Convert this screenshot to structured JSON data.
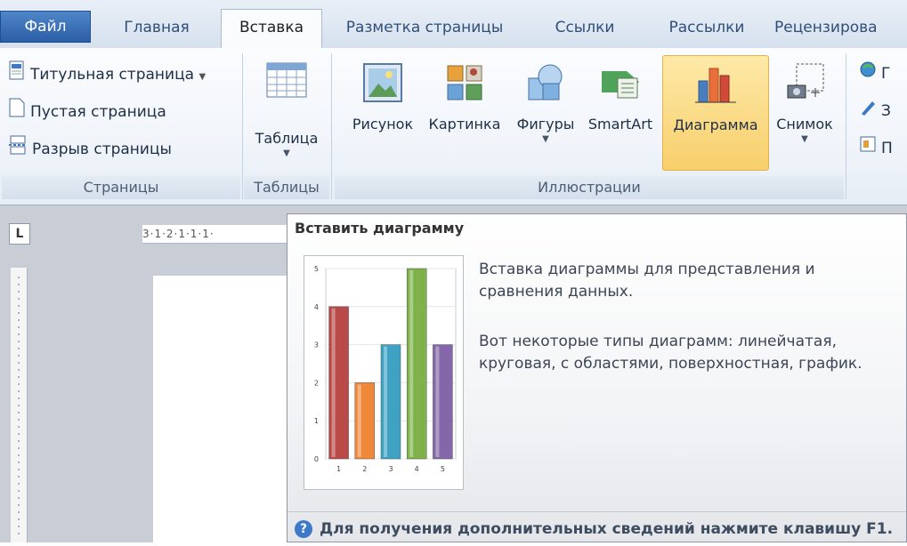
{
  "tabs": [
    "Файл",
    "Главная",
    "Вставка",
    "Разметка страницы",
    "Ссылки",
    "Рассылки",
    "Рецензирова"
  ],
  "active_tab": "Вставка",
  "groups": {
    "pages": {
      "label": "Страницы",
      "items": [
        "Титульная страница",
        "Пустая страница",
        "Разрыв страницы"
      ]
    },
    "tables": {
      "label": "Таблицы",
      "table_button": "Таблица"
    },
    "illustrations": {
      "label": "Иллюстрации",
      "buttons": [
        "Рисунок",
        "Картинка",
        "Фигуры",
        "SmartArt",
        "Диаграмма",
        "Снимок"
      ]
    },
    "links": {
      "items": [
        "Г",
        "З",
        "П"
      ]
    }
  },
  "ruler": {
    "text": "3·1·2·1·1·1·"
  },
  "tooltip": {
    "title": "Вставить диаграмму",
    "description": "Вставка диаграммы для представления и сравнения данных.",
    "types": "Вот некоторые типы диаграмм: линейчатая, круговая, с областями, поверхностная, график.",
    "help": "Для получения дополнительных сведений нажмите клавишу F1."
  },
  "chart_data": {
    "type": "bar",
    "categories": [
      "1",
      "2",
      "3",
      "4",
      "5"
    ],
    "values": [
      4,
      2,
      3,
      5,
      3
    ],
    "y_ticks": [
      "0",
      "1",
      "2",
      "3",
      "4",
      "5"
    ],
    "ylim": [
      0,
      5
    ],
    "colors": [
      "#b94a48",
      "#f0883a",
      "#3fa1c4",
      "#7fb24a",
      "#8467a8"
    ]
  },
  "colors": {
    "file_tab": "#2a5ea6",
    "highlight": "#f8cf6b",
    "tooltip_border": "#8d96a4"
  }
}
